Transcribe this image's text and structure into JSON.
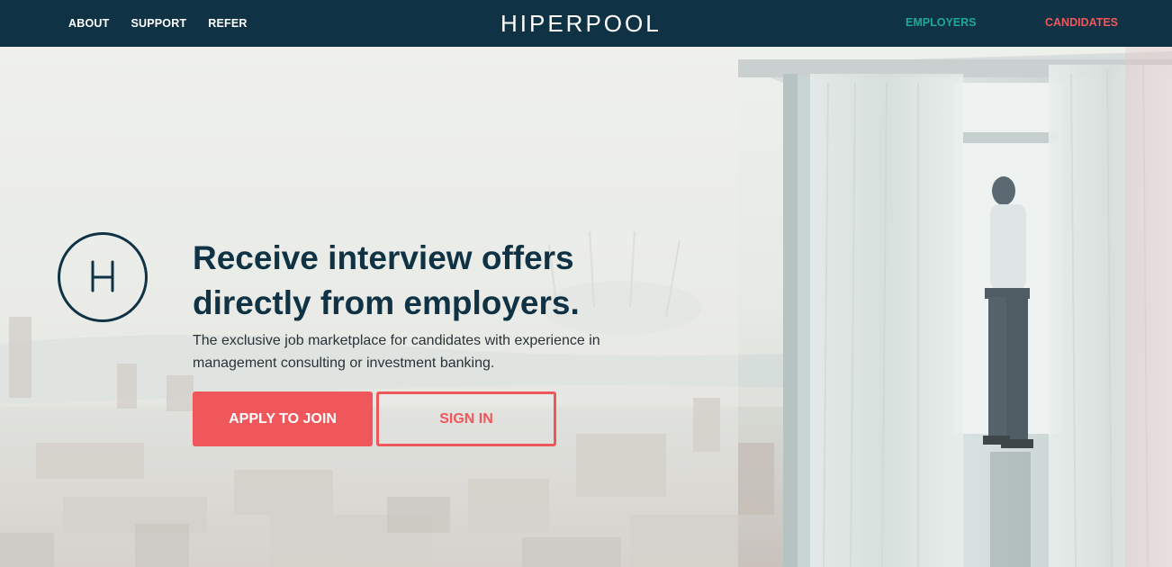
{
  "nav": {
    "links": [
      "ABOUT",
      "SUPPORT",
      "REFER"
    ],
    "logo": "HIPERPOOL",
    "employers": "EMPLOYERS",
    "candidates": "CANDIDATES"
  },
  "hero": {
    "headline_line1": "Receive interview offers",
    "headline_line2": "directly from employers.",
    "sub_line1": "The exclusive job marketplace for candidates with experience in",
    "sub_line2": "management consulting or investment banking.",
    "apply_label": "APPLY TO JOIN",
    "signin_label": "SIGN IN",
    "mark_icon": "h-logo-circle-icon"
  },
  "colors": {
    "navy": "#0f3345",
    "coral": "#f0575a",
    "teal": "#1fa79a"
  }
}
